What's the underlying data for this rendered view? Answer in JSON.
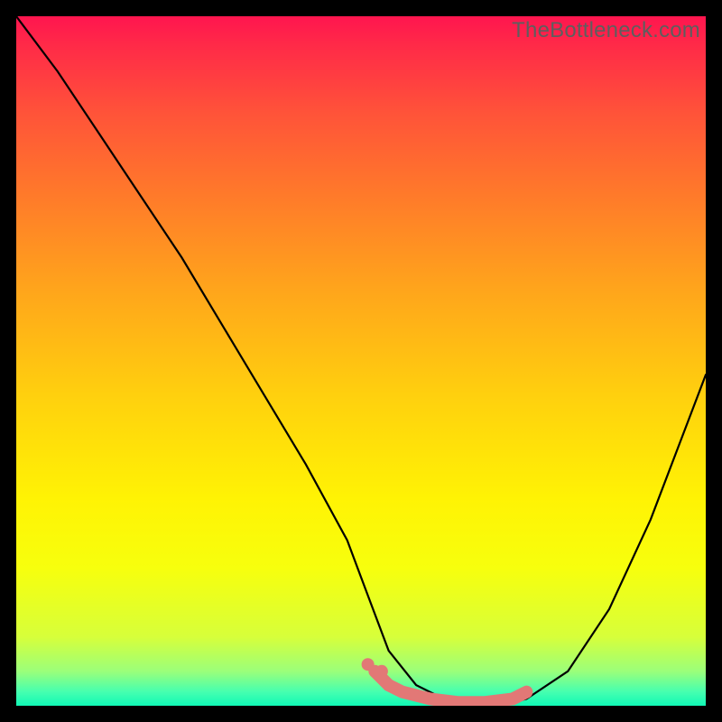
{
  "watermark": "TheBottleneck.com",
  "chart_data": {
    "type": "line",
    "title": "",
    "xlabel": "",
    "ylabel": "",
    "xlim": [
      0,
      100
    ],
    "ylim": [
      0,
      100
    ],
    "series": [
      {
        "name": "bottleneck-curve",
        "x": [
          0,
          6,
          12,
          18,
          24,
          30,
          36,
          42,
          48,
          51,
          54,
          58,
          62,
          66,
          70,
          74,
          80,
          86,
          92,
          100
        ],
        "values": [
          100,
          92,
          83,
          74,
          65,
          55,
          45,
          35,
          24,
          16,
          8,
          3,
          1,
          0,
          0,
          1,
          5,
          14,
          27,
          48
        ]
      },
      {
        "name": "highlight-band",
        "x": [
          52,
          54,
          56,
          60,
          64,
          68,
          72,
          74
        ],
        "values": [
          5,
          3,
          2,
          1,
          0.5,
          0.5,
          1,
          2
        ]
      }
    ],
    "background_gradient": {
      "top": "#ff154f",
      "mid": "#ffd00e",
      "bottom": "#10f8b5"
    },
    "highlight_color": "#e27876"
  }
}
